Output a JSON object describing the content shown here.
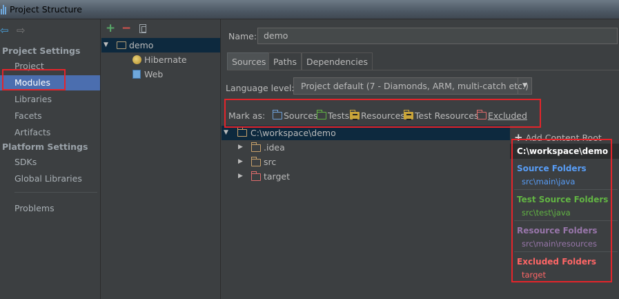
{
  "window": {
    "title": "Project Structure"
  },
  "nav": {
    "project_settings_heading": "Project Settings",
    "platform_settings_heading": "Platform Settings",
    "items": [
      {
        "label": "Project"
      },
      {
        "label": "Modules"
      },
      {
        "label": "Libraries"
      },
      {
        "label": "Facets"
      },
      {
        "label": "Artifacts"
      },
      {
        "label": "SDKs"
      },
      {
        "label": "Global Libraries"
      },
      {
        "label": "Problems"
      }
    ],
    "selected": "Modules"
  },
  "module_tree": {
    "root": "demo",
    "children": [
      {
        "label": "Hibernate",
        "icon": "hibernate-icon"
      },
      {
        "label": "Web",
        "icon": "web-icon"
      }
    ]
  },
  "name_field": {
    "label": "Name:",
    "value": "demo"
  },
  "tabs": [
    {
      "label": "Sources"
    },
    {
      "label": "Paths"
    },
    {
      "label": "Dependencies"
    }
  ],
  "active_tab": "Sources",
  "language_level": {
    "label": "Language level:",
    "value": "Project default (7 - Diamonds, ARM, multi-catch etc.)"
  },
  "mark_as": {
    "label": "Mark as:",
    "options": [
      {
        "label": "Sources",
        "color": "#6fa0d8"
      },
      {
        "label": "Tests",
        "color": "#62b543"
      },
      {
        "label": "Resources",
        "color": "#c9a53a"
      },
      {
        "label": "Test Resources",
        "color": "#c9a53a"
      },
      {
        "label": "Excluded",
        "color": "#e06c6c"
      }
    ]
  },
  "file_tree": {
    "root": "C:\\workspace\\demo",
    "children": [
      {
        "label": ".idea",
        "color": "#c9a26b"
      },
      {
        "label": "src",
        "color": "#c9a26b"
      },
      {
        "label": "target",
        "color": "#e06c6c"
      }
    ]
  },
  "content_roots": {
    "add_label": "Add Content Root",
    "root_path": "C:\\workspace\\demo",
    "groups": [
      {
        "heading": "Source Folders",
        "path": "src\\main\\java",
        "color": "#589df6"
      },
      {
        "heading": "Test Source Folders",
        "path": "src\\test\\java",
        "color": "#62b543"
      },
      {
        "heading": "Resource Folders",
        "path": "src\\main\\resources",
        "color": "#9876aa"
      },
      {
        "heading": "Excluded Folders",
        "path": "target",
        "color": "#ff6666"
      }
    ]
  }
}
